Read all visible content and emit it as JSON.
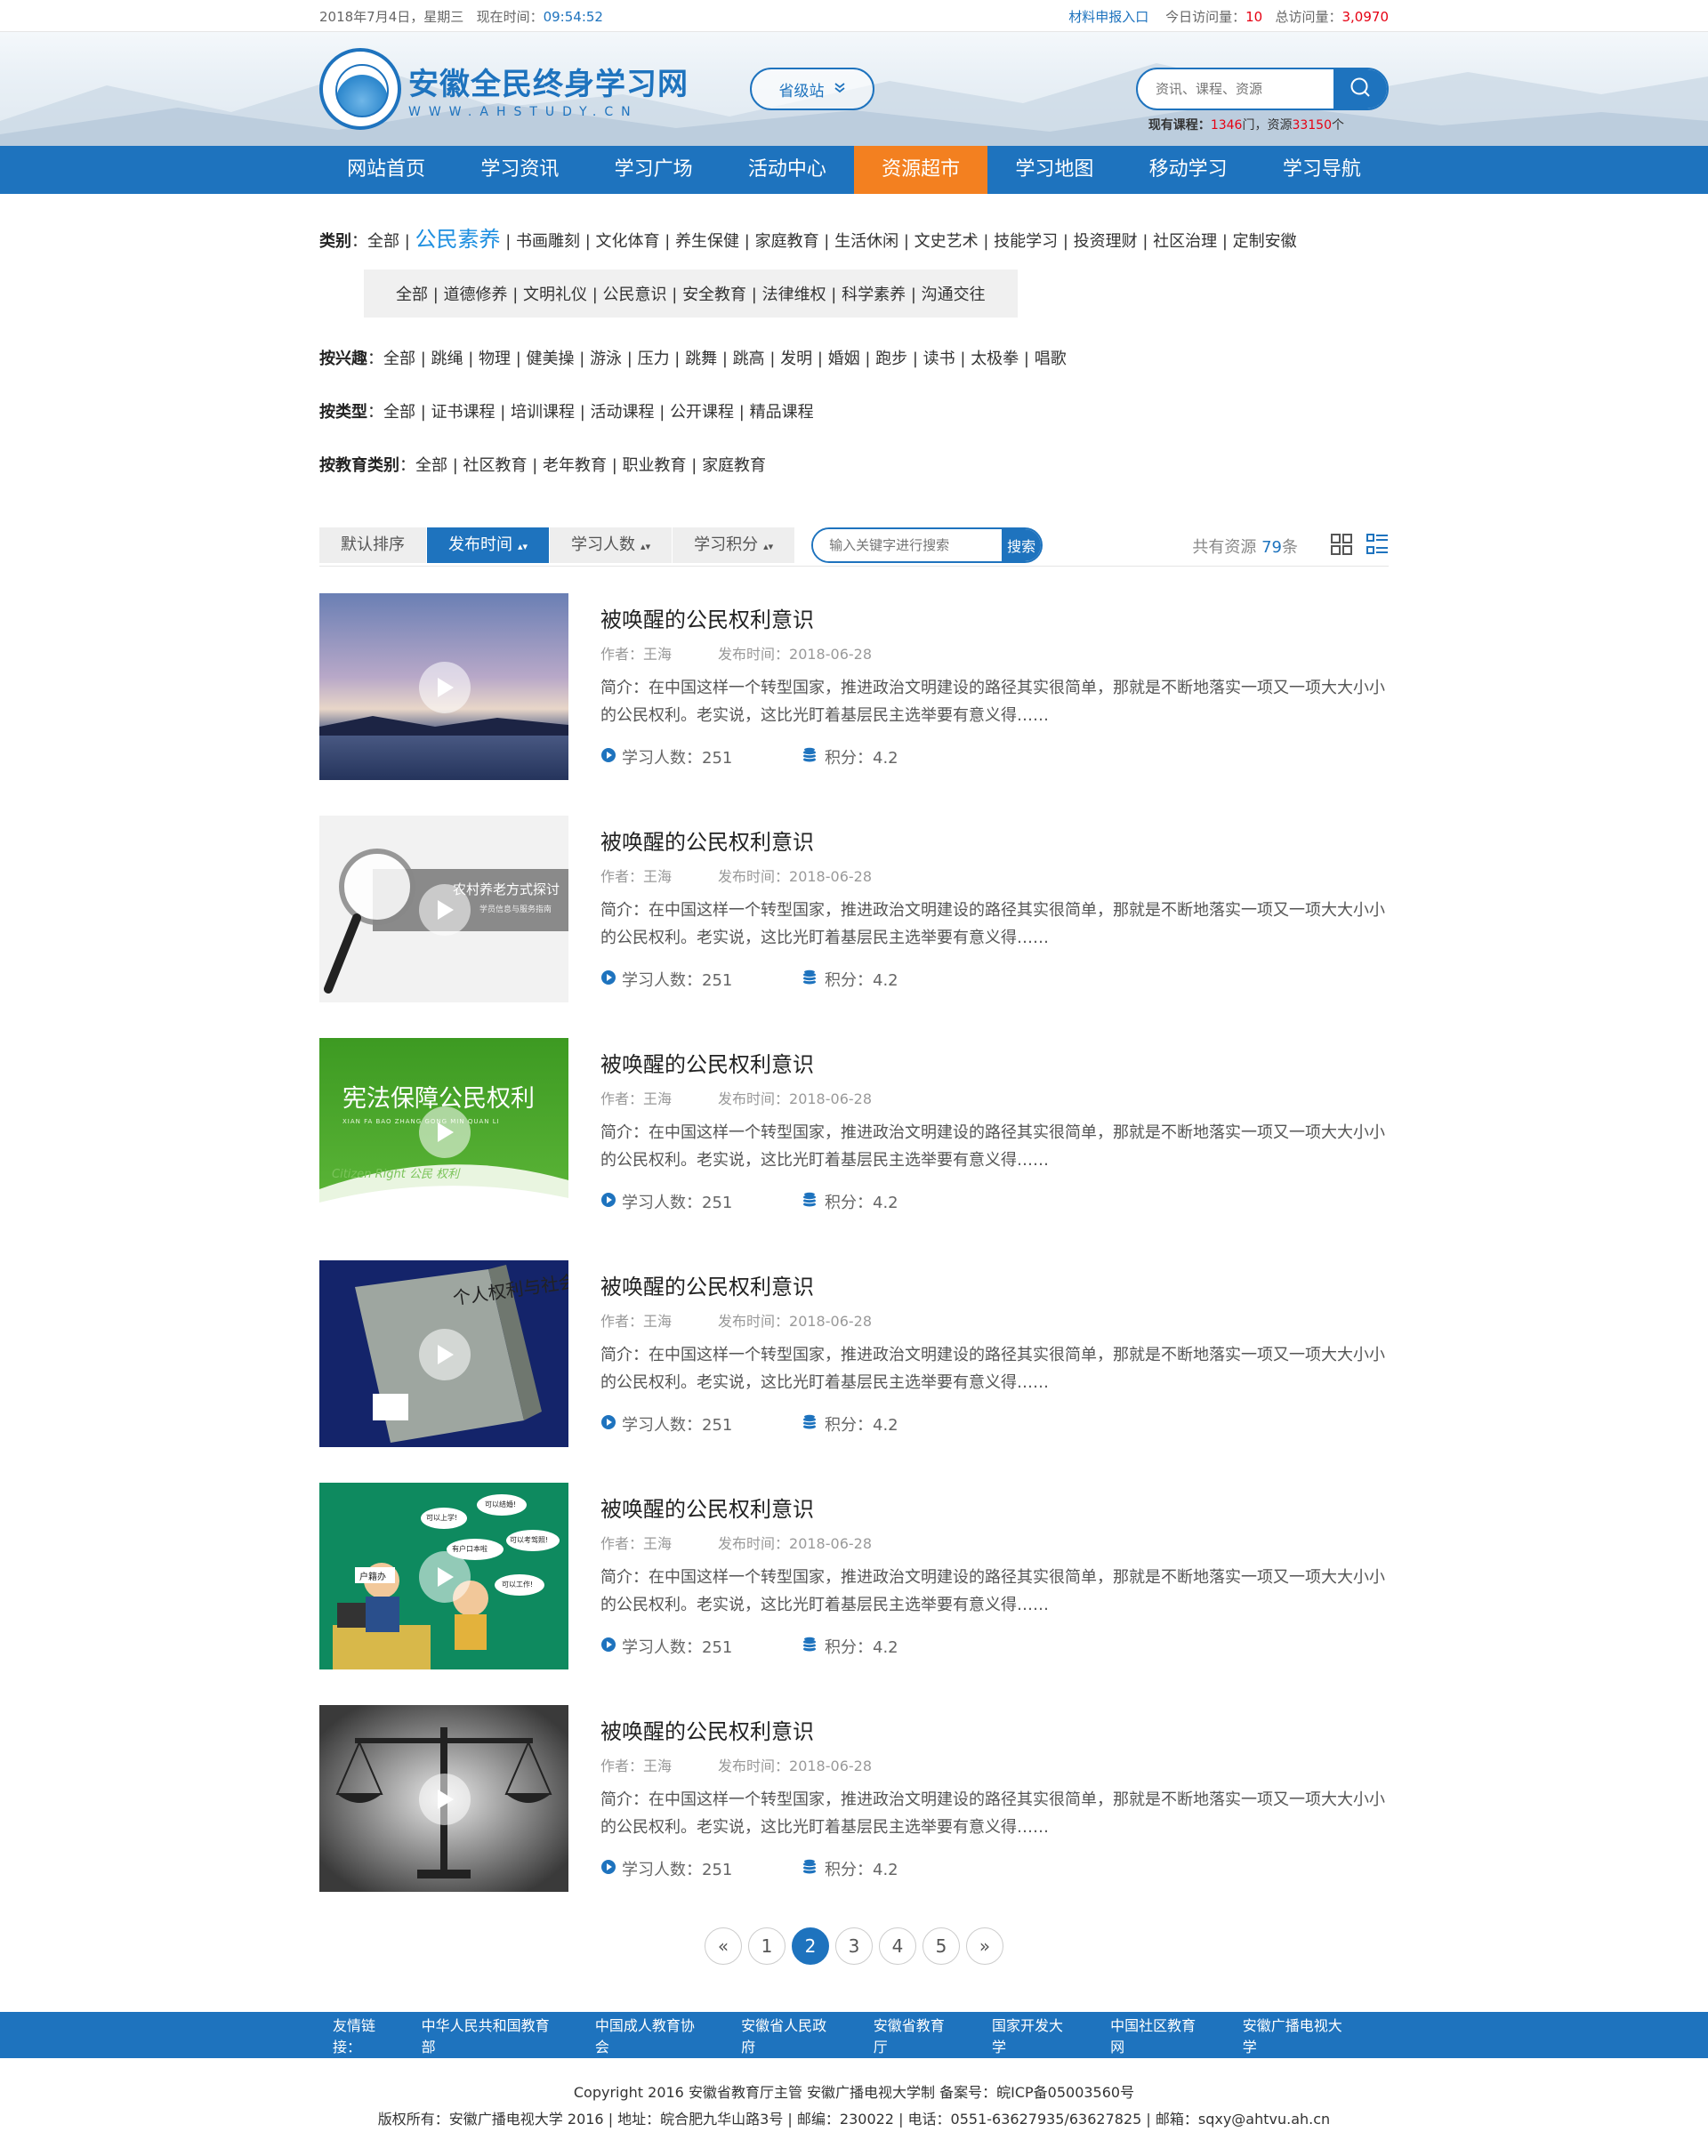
{
  "topbar": {
    "date": "2018年7月4日，星期三",
    "time_label": "现在时间：",
    "time_value": "09:54:52",
    "report_link": "材料申报入口",
    "today_label": "今日访问量：",
    "today_value": "10",
    "total_label": "总访问量：",
    "total_value": "3,0970"
  },
  "header": {
    "logo_title": "安徽全民终身学习网",
    "logo_sub": "WWW.AHSTUDY.CN",
    "site_switch": "省级站",
    "search_placeholder": "资讯、课程、资源",
    "stats_prefix": "现有课程：",
    "courses": "1346",
    "stats_mid": "门，资源",
    "resources": "33150",
    "stats_suffix": "个"
  },
  "nav": [
    "网站首页",
    "学习资讯",
    "学习广场",
    "活动中心",
    "资源超市",
    "学习地图",
    "移动学习",
    "学习导航"
  ],
  "nav_active": 4,
  "filters": {
    "category_label": "类别",
    "category_all": "全部",
    "category_selected": "公民素养",
    "category_items": [
      "书画雕刻",
      "文化体育",
      "养生保健",
      "家庭教育",
      "生活休闲",
      "文史艺术",
      "技能学习",
      "投资理财",
      "社区治理",
      "定制安徽"
    ],
    "sub_items": [
      "全部",
      "道德修养",
      "文明礼仪"
    ],
    "sub_selected": "公民意识",
    "sub_items_after": [
      "安全教育",
      "法律维权",
      "科学素养",
      "沟通交往"
    ],
    "interest_label": "按兴趣",
    "interest_items": [
      "全部",
      "跳绳",
      "物理",
      "健美操",
      "游泳",
      "压力",
      "跳舞",
      "跳高",
      "发明",
      "婚姻",
      "跑步",
      "读书",
      "太极拳",
      "唱歌"
    ],
    "type_label": "按类型",
    "type_items": [
      "全部",
      "证书课程",
      "培训课程",
      "活动课程",
      "公开课程",
      "精品课程"
    ],
    "edu_label": "按教育类别",
    "edu_items": [
      "全部",
      "社区教育",
      "老年教育",
      "职业教育",
      "家庭教育"
    ]
  },
  "toolbar": {
    "sort_default": "默认排序",
    "sort_time": "发布时间",
    "sort_learners": "学习人数",
    "sort_points": "学习积分",
    "keyword_placeholder": "输入关键字进行搜索",
    "search_btn": "搜索",
    "total_prefix": "共有资源",
    "total_num": "79",
    "total_suffix": "条"
  },
  "items": [
    {
      "title": "被唤醒的公民权利意识",
      "author": "作者：王海",
      "date": "发布时间：2018-06-28",
      "desc": "简介：在中国这样一个转型国家，推进政治文明建设的路径其实很简单，那就是不断地落实一项又一项大大小小的公民权利。老实说，这比光盯着基层民主选举要有意义得……",
      "learners": "学习人数：251",
      "points": "积分：4.2"
    },
    {
      "title": "被唤醒的公民权利意识",
      "author": "作者：王海",
      "date": "发布时间：2018-06-28",
      "desc": "简介：在中国这样一个转型国家，推进政治文明建设的路径其实很简单，那就是不断地落实一项又一项大大小小的公民权利。老实说，这比光盯着基层民主选举要有意义得……",
      "learners": "学习人数：251",
      "points": "积分：4.2",
      "thumb_text": "农村养老方式探讨",
      "thumb_sub": "学员信息与服务指南"
    },
    {
      "title": "被唤醒的公民权利意识",
      "author": "作者：王海",
      "date": "发布时间：2018-06-28",
      "desc": "简介：在中国这样一个转型国家，推进政治文明建设的路径其实很简单，那就是不断地落实一项又一项大大小小的公民权利。老实说，这比光盯着基层民主选举要有意义得……",
      "learners": "学习人数：251",
      "points": "积分：4.2",
      "thumb_text": "宪法保障公民权利",
      "thumb_sub": "XIAN FA BAO ZHANG GONG MIN QUAN LI",
      "thumb_sub2": "Citizen Right   公民 权利"
    },
    {
      "title": "被唤醒的公民权利意识",
      "author": "作者：王海",
      "date": "发布时间：2018-06-28",
      "desc": "简介：在中国这样一个转型国家，推进政治文明建设的路径其实很简单，那就是不断地落实一项又一项大大小小的公民权利。老实说，这比光盯着基层民主选举要有意义得……",
      "learners": "学习人数：251",
      "points": "积分：4.2",
      "thumb_text": "个人权利与社会意识"
    },
    {
      "title": "被唤醒的公民权利意识",
      "author": "作者：王海",
      "date": "发布时间：2018-06-28",
      "desc": "简介：在中国这样一个转型国家，推进政治文明建设的路径其实很简单，那就是不断地落实一项又一项大大小小的公民权利。老实说，这比光盯着基层民主选举要有意义得……",
      "learners": "学习人数：251",
      "points": "积分：4.2",
      "thumb_text": "户籍办",
      "thumb_b1": "可以上学!",
      "thumb_b2": "可以结婚!",
      "thumb_b3": "可以考驾照!",
      "thumb_b4": "有户口本啦",
      "thumb_b5": "可以工作!"
    },
    {
      "title": "被唤醒的公民权利意识",
      "author": "作者：王海",
      "date": "发布时间：2018-06-28",
      "desc": "简介：在中国这样一个转型国家，推进政治文明建设的路径其实很简单，那就是不断地落实一项又一项大大小小的公民权利。老实说，这比光盯着基层民主选举要有意义得……",
      "learners": "学习人数：251",
      "points": "积分：4.2"
    }
  ],
  "pager": {
    "prev": "«",
    "pages": [
      "1",
      "2",
      "3",
      "4",
      "5"
    ],
    "current": "2",
    "next": "»"
  },
  "friend_links": {
    "label": "友情链接：",
    "links": [
      "中华人民共和国教育部",
      "中国成人教育协会",
      "安徽省人民政府",
      "安徽省教育厅",
      "国家开发大学",
      "中国社区教育网",
      "安徽广播电视大学"
    ]
  },
  "footer": {
    "line1": "Copyright 2016 安徽省教育厅主管 安徽广播电视大学制 备案号：皖ICP备05003560号",
    "line2": "版权所有：安徽广播电视大学 2016 | 地址：皖合肥九华山路3号 | 邮编：230022 | 电话：0551-63627935/63627825 | 邮箱：sqxy@ahtvu.ah.cn"
  },
  "colors": {
    "brand": "#1e73be",
    "accent": "#f38020",
    "highlight": "#e60012"
  }
}
